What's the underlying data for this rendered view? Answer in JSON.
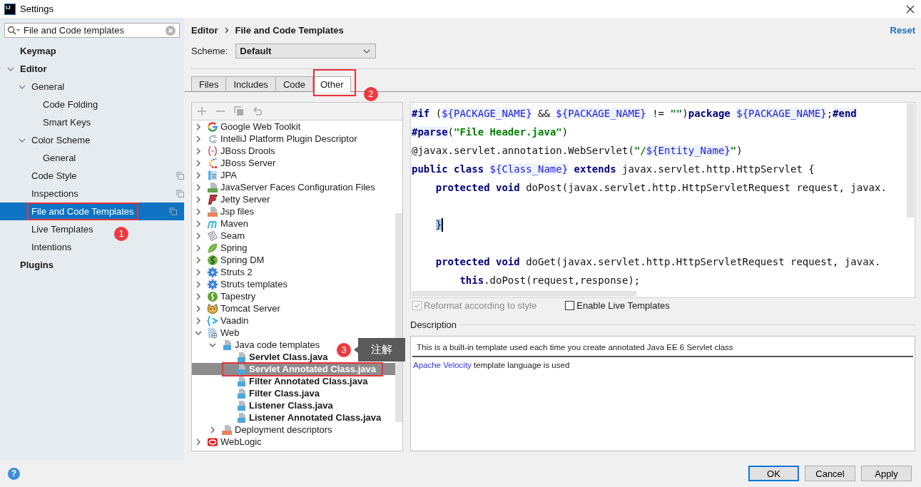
{
  "window": {
    "logo": "IJ",
    "title": "Settings"
  },
  "sidebar": {
    "search": {
      "value": "File and Code templates"
    },
    "items": [
      {
        "label": "Keymap",
        "selected": false,
        "project_level": false
      },
      {
        "label": "Editor",
        "selected": false,
        "project_level": false,
        "expanded": true,
        "children": [
          {
            "label": "General",
            "selected": false,
            "project_level": false,
            "expanded": true,
            "children": [
              {
                "label": "Code Folding",
                "selected": false,
                "project_level": false
              },
              {
                "label": "Smart Keys",
                "selected": false,
                "project_level": false
              }
            ]
          },
          {
            "label": "Color Scheme",
            "selected": false,
            "project_level": false,
            "expanded": true,
            "children": [
              {
                "label": "General",
                "selected": false,
                "project_level": false
              }
            ]
          },
          {
            "label": "Code Style",
            "selected": false,
            "project_level": true
          },
          {
            "label": "Inspections",
            "selected": false,
            "project_level": true
          },
          {
            "label": "File and Code Templates",
            "selected": true,
            "project_level": true,
            "annotation": {
              "number": "1"
            }
          },
          {
            "label": "Live Templates",
            "selected": false,
            "project_level": false
          },
          {
            "label": "Intentions",
            "selected": false,
            "project_level": false
          }
        ]
      },
      {
        "label": "Plugins",
        "selected": false,
        "project_level": false
      }
    ]
  },
  "main": {
    "breadcrumb": [
      "Editor",
      "File and Code Templates"
    ],
    "reset": "Reset",
    "scheme": {
      "label": "Scheme:",
      "value": "Default"
    },
    "tabs": [
      {
        "label": "Files",
        "selected": false
      },
      {
        "label": "Includes",
        "selected": false
      },
      {
        "label": "Code",
        "selected": false
      },
      {
        "label": "Other",
        "selected": true,
        "annotation": {
          "number": "2"
        }
      }
    ],
    "tree": {
      "toolbar": {
        "disabled": true
      },
      "items": [
        {
          "label": "Google Web Toolkit",
          "kind": "group",
          "expanded": false,
          "selected": false
        },
        {
          "label": "IntelliJ Platform Plugin Descriptor",
          "kind": "group",
          "expanded": false,
          "selected": false
        },
        {
          "label": "JBoss Drools",
          "kind": "group",
          "expanded": false,
          "selected": false
        },
        {
          "label": "JBoss Server",
          "kind": "group",
          "expanded": false,
          "selected": false
        },
        {
          "label": "JPA",
          "kind": "group",
          "expanded": false,
          "selected": false
        },
        {
          "label": "JavaServer Faces Configuration Files",
          "kind": "group",
          "expanded": false,
          "selected": false
        },
        {
          "label": "Jetty Server",
          "kind": "group",
          "expanded": false,
          "selected": false
        },
        {
          "label": "Jsp files",
          "kind": "group",
          "expanded": false,
          "selected": false
        },
        {
          "label": "Maven",
          "kind": "group",
          "expanded": false,
          "selected": false
        },
        {
          "label": "Seam",
          "kind": "group",
          "expanded": false,
          "selected": false
        },
        {
          "label": "Spring",
          "kind": "group",
          "expanded": false,
          "selected": false
        },
        {
          "label": "Spring DM",
          "kind": "group",
          "expanded": false,
          "selected": false
        },
        {
          "label": "Struts 2",
          "kind": "group",
          "expanded": false,
          "selected": false
        },
        {
          "label": "Struts templates",
          "kind": "group",
          "expanded": false,
          "selected": false
        },
        {
          "label": "Tapestry",
          "kind": "group",
          "expanded": false,
          "selected": false
        },
        {
          "label": "Tomcat Server",
          "kind": "group",
          "expanded": false,
          "selected": false
        },
        {
          "label": "Vaadin",
          "kind": "group",
          "expanded": false,
          "selected": false
        },
        {
          "label": "Web",
          "kind": "group",
          "expanded": true,
          "selected": false,
          "children": [
            {
              "label": "Java code templates",
              "kind": "group",
              "expanded": true,
              "selected": false,
              "children": [
                {
                  "label": "Servlet Class.java",
                  "kind": "template",
                  "selected": false
                },
                {
                  "label": "Servlet Annotated Class.java",
                  "kind": "template",
                  "selected": true,
                  "annotation": {
                    "number": "3",
                    "note": "注解"
                  }
                },
                {
                  "label": "Filter Annotated Class.java",
                  "kind": "template",
                  "selected": false
                },
                {
                  "label": "Filter Class.java",
                  "kind": "template",
                  "selected": false
                },
                {
                  "label": "Listener Class.java",
                  "kind": "template",
                  "selected": false
                },
                {
                  "label": "Listener Annotated Class.java",
                  "kind": "template",
                  "selected": false
                }
              ]
            },
            {
              "label": "Deployment descriptors",
              "kind": "group",
              "expanded": false,
              "selected": false
            }
          ]
        },
        {
          "label": "WebLogic",
          "kind": "group",
          "expanded": false,
          "selected": false
        }
      ]
    },
    "editor": {
      "lines": [
        {
          "kind": "code",
          "caret": false,
          "tokens": [
            {
              "text": "#if",
              "kind": "directive"
            },
            {
              "text": " (",
              "kind": "plain"
            },
            {
              "text": "${PACKAGE_NAME}",
              "kind": "variable"
            },
            {
              "text": " && ",
              "kind": "plain"
            },
            {
              "text": "${PACKAGE_NAME}",
              "kind": "variable"
            },
            {
              "text": " != ",
              "kind": "plain"
            },
            {
              "text": "\"\"",
              "kind": "string"
            },
            {
              "text": ")",
              "kind": "plain"
            },
            {
              "text": "package ",
              "kind": "keyword"
            },
            {
              "text": "${PACKAGE_NAME}",
              "kind": "variable"
            },
            {
              "text": ";",
              "kind": "plain"
            },
            {
              "text": "#end",
              "kind": "directive"
            }
          ]
        },
        {
          "kind": "code",
          "caret": false,
          "tokens": [
            {
              "text": "#parse",
              "kind": "directive"
            },
            {
              "text": "(",
              "kind": "plain"
            },
            {
              "text": "\"File Header.java\"",
              "kind": "string"
            },
            {
              "text": ")",
              "kind": "plain"
            }
          ]
        },
        {
          "kind": "code",
          "caret": false,
          "tokens": [
            {
              "text": "@javax.servlet.annotation.WebServlet(",
              "kind": "plain"
            },
            {
              "text": "\"/",
              "kind": "string"
            },
            {
              "text": "${Entity_Name}",
              "kind": "variable"
            },
            {
              "text": "\"",
              "kind": "string"
            },
            {
              "text": ")",
              "kind": "plain"
            }
          ]
        },
        {
          "kind": "code",
          "caret": false,
          "tokens": [
            {
              "text": "public class ",
              "kind": "keyword"
            },
            {
              "text": "${Class_Name}",
              "kind": "variable"
            },
            {
              "text": " extends ",
              "kind": "keyword"
            },
            {
              "text": "javax.servlet.http.HttpServlet {",
              "kind": "plain"
            }
          ],
          "children": [
            {
              "kind": "code",
              "caret": false,
              "tokens": [
                {
                  "text": "protected void ",
                  "kind": "keyword"
                },
                {
                  "text": "doPost(javax.servlet.http.HttpServletRequest request, javax.",
                  "kind": "plain"
                }
              ]
            },
            {
              "kind": "blank"
            },
            {
              "kind": "code",
              "caret": true,
              "tokens": [
                {
                  "text": "}",
                  "kind": "highlight"
                }
              ]
            },
            {
              "kind": "blank"
            },
            {
              "kind": "code",
              "caret": false,
              "tokens": [
                {
                  "text": "protected void ",
                  "kind": "keyword"
                },
                {
                  "text": "doGet(javax.servlet.http.HttpServletRequest request, javax.",
                  "kind": "plain"
                }
              ],
              "children": [
                {
                  "kind": "code",
                  "caret": false,
                  "tokens": [
                    {
                      "text": "this",
                      "kind": "keyword"
                    },
                    {
                      "text": ".doPost(request,response);",
                      "kind": "plain"
                    }
                  ]
                }
              ]
            }
          ]
        }
      ]
    },
    "options": [
      {
        "label": "Reformat according to style",
        "checked": true,
        "disabled": true
      },
      {
        "label": "Enable Live Templates",
        "checked": false,
        "disabled": false
      }
    ],
    "description": {
      "title": "Description",
      "text": "This is a built-in template used each time you create annotated Java EE 6 Servlet class",
      "link": "Apache Velocity",
      "note": "template language is used"
    }
  },
  "footer": {
    "help": "?",
    "buttons": [
      {
        "label": "OK",
        "default": true
      },
      {
        "label": "Cancel",
        "default": false
      },
      {
        "label": "Apply",
        "default": false
      }
    ]
  }
}
